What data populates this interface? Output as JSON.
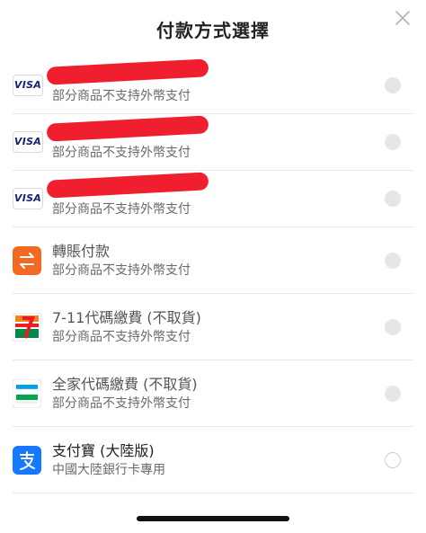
{
  "header": {
    "title": "付款方式選擇",
    "close_icon": "close-x-icon"
  },
  "methods": [
    {
      "type": "visa",
      "icon_text": "VISA",
      "subtitle": "部分商品不支持外幣支付"
    },
    {
      "type": "visa",
      "icon_text": "VISA",
      "subtitle": "部分商品不支持外幣支付"
    },
    {
      "type": "visa",
      "icon_text": "VISA",
      "subtitle": "部分商品不支持外幣支付"
    },
    {
      "type": "transfer",
      "name": "轉賬付款",
      "subtitle": "部分商品不支持外幣支付",
      "icon": "transfer-arrows-icon",
      "icon_color": "#f26a21"
    },
    {
      "type": "711",
      "name": "7-11代碼繳費 (不取貨)",
      "subtitle": "部分商品不支持外幣支付",
      "icon": "seven-eleven-icon"
    },
    {
      "type": "familymart",
      "name": "全家代碼繳費 (不取貨)",
      "subtitle": "部分商品不支持外幣支付",
      "icon": "familymart-icon"
    },
    {
      "type": "alipay",
      "name": "支付寶 (大陸版)",
      "subtitle": "中國大陸銀行卡專用",
      "icon": "alipay-icon",
      "icon_color": "#1677ff"
    }
  ],
  "colors": {
    "redaction": "#f01f2f",
    "radio_disabled": "#e6e6e6",
    "radio_border": "#cfcfcf"
  }
}
